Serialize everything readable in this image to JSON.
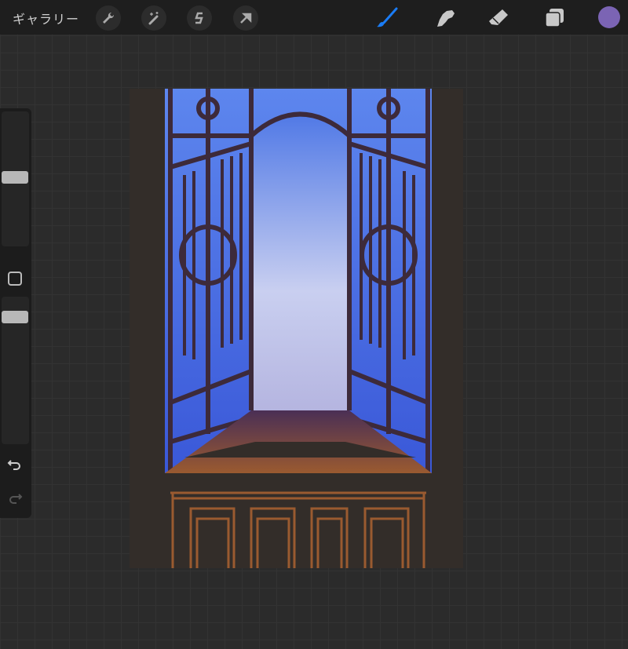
{
  "topbar": {
    "gallery_label": "ギャラリー",
    "left_tools": [
      "wrench-icon",
      "magic-wand-icon",
      "selection-s-icon",
      "move-arrow-icon"
    ],
    "right_tools": [
      "brush-icon",
      "smudge-icon",
      "eraser-icon",
      "layers-icon"
    ],
    "active_tool_color": "#1a7cf5",
    "current_color": "#7b64b4"
  },
  "sidebar": {
    "brush_size_fraction": 0.5,
    "opacity_fraction": 0.95
  },
  "canvas": {
    "background": "#332d29"
  }
}
